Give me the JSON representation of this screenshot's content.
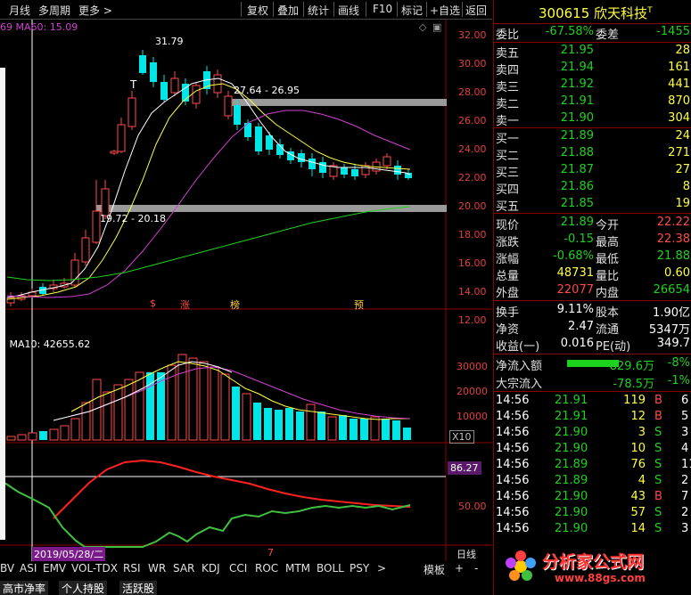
{
  "toolbar": {
    "period": "月线",
    "multi": "多周期",
    "more": "更多 >",
    "restore": "复权",
    "overlay": "叠加",
    "stats": "统计",
    "draw": "画线",
    "f10": "F10",
    "mark": "标记",
    "add_fav": "+自选",
    "back": "返回"
  },
  "main_chart": {
    "ma_label": "69  MA60: 15.09",
    "annotation_high": "31.79",
    "annotation_range_top": "27.64 - 26.95",
    "annotation_range_bottom": "19.72 - 20.18",
    "t_marker": "T",
    "y_ticks": [
      "32.00",
      "30.00",
      "28.00",
      "26.00",
      "24.00",
      "22.00",
      "20.00",
      "18.00",
      "16.00",
      "14.00",
      "12.00"
    ],
    "markers": [
      "$",
      "涨",
      "榜",
      "预"
    ]
  },
  "volume_chart": {
    "label": "5  MA10: 42655.62",
    "y_ticks": [
      "30000",
      "20000",
      "10000"
    ],
    "unit": "X10"
  },
  "indicator_chart": {
    "value_badge": "86.27",
    "level": "50.00",
    "date_label": "2019/05/28/二",
    "mid_tick": "7",
    "right_label": "日线"
  },
  "bottom_tabs": [
    "BV",
    "ASI",
    "EMV",
    "VOL-TDX",
    "RSI",
    "WR",
    "SAR",
    "KDJ",
    "CCI",
    "ROC",
    "MTM",
    "BOLL",
    "PSY",
    ">"
  ],
  "bottom_tools": {
    "template": "模板",
    "plus": "+",
    "minus": "-"
  },
  "status_bar": [
    "高市净率",
    "个人持股",
    "活跃股"
  ],
  "quote": {
    "code": "300615",
    "name": "欣天科技",
    "name_mark": "T",
    "weibi_label": "委比",
    "weibi": "-67.58%",
    "weicha_label": "委差",
    "weicha": "-1455",
    "sells": [
      {
        "label": "卖五",
        "price": "21.95",
        "vol": "28"
      },
      {
        "label": "卖四",
        "price": "21.94",
        "vol": "161"
      },
      {
        "label": "卖三",
        "price": "21.92",
        "vol": "441"
      },
      {
        "label": "卖二",
        "price": "21.91",
        "vol": "870"
      },
      {
        "label": "卖一",
        "price": "21.90",
        "vol": "304"
      }
    ],
    "buys": [
      {
        "label": "买一",
        "price": "21.89",
        "vol": "24"
      },
      {
        "label": "买二",
        "price": "21.88",
        "vol": "271"
      },
      {
        "label": "买三",
        "price": "21.87",
        "vol": "27"
      },
      {
        "label": "买四",
        "price": "21.86",
        "vol": "8"
      },
      {
        "label": "买五",
        "price": "21.85",
        "vol": "19"
      }
    ],
    "stats": [
      {
        "k1": "现价",
        "v1": "21.89",
        "k2": "今开",
        "v2": "22.22"
      },
      {
        "k1": "涨跌",
        "v1": "-0.15",
        "k2": "最高",
        "v2": "22.38"
      },
      {
        "k1": "涨幅",
        "v1": "-0.68%",
        "k2": "最低",
        "v2": "21.88"
      },
      {
        "k1": "总量",
        "v1": "48731",
        "k2": "量比",
        "v2": "0.60"
      },
      {
        "k1": "外盘",
        "v1": "22077",
        "k2": "内盘",
        "v2": "26654"
      }
    ],
    "stats2": [
      {
        "k1": "换手",
        "v1": "9.11%",
        "k2": "股本",
        "v2": "1.90亿"
      },
      {
        "k1": "净资",
        "v1": "2.47",
        "k2": "流通",
        "v2": "5347万"
      },
      {
        "k1": "收益(一)",
        "v1": "0.016",
        "k2": "PE(动)",
        "v2": "349.7"
      }
    ],
    "flow": [
      {
        "k": "净流入额",
        "v": "-829.6万",
        "p": "-8%"
      },
      {
        "k": "大宗流入",
        "v": "-78.5万",
        "p": "-1%"
      }
    ],
    "ticks": [
      {
        "t": "14:56",
        "p": "21.91",
        "v": "119",
        "d": "B",
        "n": "6"
      },
      {
        "t": "14:56",
        "p": "21.91",
        "v": "12",
        "d": "B",
        "n": "5"
      },
      {
        "t": "14:56",
        "p": "21.90",
        "v": "3",
        "d": "S",
        "n": "3"
      },
      {
        "t": "14:56",
        "p": "21.90",
        "v": "10",
        "d": "S",
        "n": "4"
      },
      {
        "t": "14:56",
        "p": "21.89",
        "v": "76",
        "d": "S",
        "n": "11"
      },
      {
        "t": "14:56",
        "p": "21.89",
        "v": "4",
        "d": "S",
        "n": "2"
      },
      {
        "t": "14:56",
        "p": "21.90",
        "v": "43",
        "d": "B",
        "n": "7"
      },
      {
        "t": "14:56",
        "p": "21.90",
        "v": "57",
        "d": "S",
        "n": "2"
      },
      {
        "t": "14:56",
        "p": "21.90",
        "v": "14",
        "d": "S",
        "n": "3"
      }
    ]
  },
  "watermark": {
    "title": "分析家公式网",
    "url": "www.88gs.com"
  }
}
